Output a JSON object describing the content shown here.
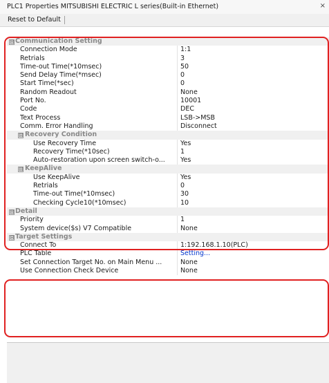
{
  "window": {
    "title": "PLC1 Properties MITSUBISHI ELECTRIC L series(Built-in Ethernet)",
    "close": "×"
  },
  "toolbar": {
    "reset_label": "Reset to Default"
  },
  "grid": {
    "expanded_symbol": "⊟",
    "communication": {
      "title": "Communication Setting",
      "rows": [
        {
          "name": "Connection Mode",
          "value": "1:1"
        },
        {
          "name": "Retrials",
          "value": "3"
        },
        {
          "name": "Time-out Time(*10msec)",
          "value": "50"
        },
        {
          "name": "Send Delay Time(*msec)",
          "value": "0"
        },
        {
          "name": "Start Time(*sec)",
          "value": "0"
        },
        {
          "name": "Random Readout",
          "value": "None"
        },
        {
          "name": "Port No.",
          "value": "10001"
        },
        {
          "name": "Code",
          "value": "DEC"
        },
        {
          "name": "Text Process",
          "value": "LSB->MSB"
        },
        {
          "name": "Comm. Error Handling",
          "value": "Disconnect"
        }
      ],
      "recovery": {
        "title": "Recovery Condition",
        "rows": [
          {
            "name": "Use Recovery Time",
            "value": "Yes"
          },
          {
            "name": "Recovery Time(*10sec)",
            "value": "1"
          },
          {
            "name": "Auto-restoration upon screen switch-o...",
            "value": "Yes"
          }
        ]
      },
      "keepalive": {
        "title": "KeepAlive",
        "rows": [
          {
            "name": "Use KeepAlive",
            "value": "Yes"
          },
          {
            "name": "Retrials",
            "value": "0"
          },
          {
            "name": "Time-out Time(*10msec)",
            "value": "30"
          },
          {
            "name": "Checking Cycle10(*10msec)",
            "value": "10"
          }
        ]
      }
    },
    "detail": {
      "title": "Detail",
      "rows": [
        {
          "name": "Priority",
          "value": "1"
        },
        {
          "name": "System device($s) V7 Compatible",
          "value": "None"
        }
      ]
    },
    "target": {
      "title": "Target Settings",
      "rows": [
        {
          "name": "Connect To",
          "value": "1:192.168.1.10(PLC)"
        },
        {
          "name": "PLC Table",
          "value": "Setting..."
        },
        {
          "name": "Set Connection Target No. on Main Menu ...",
          "value": "None"
        },
        {
          "name": "Use Connection Check Device",
          "value": "None"
        }
      ]
    }
  }
}
